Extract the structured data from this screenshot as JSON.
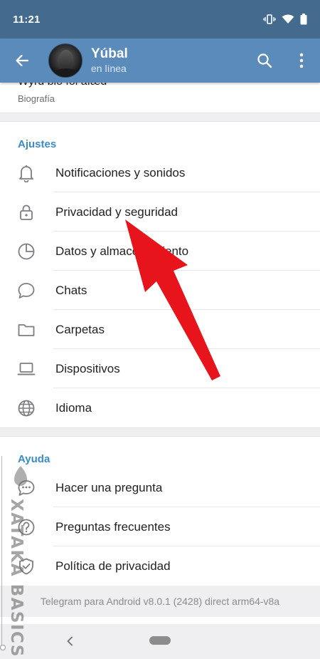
{
  "status_bar": {
    "time": "11:21"
  },
  "app_bar": {
    "name": "Yúbal",
    "status": "en línea"
  },
  "bio": {
    "value": "Wyrd bio fol afæd",
    "label": "Biografía"
  },
  "settings": {
    "header": "Ajustes",
    "items": [
      {
        "label": "Notificaciones y sonidos",
        "icon": "bell-icon"
      },
      {
        "label": "Privacidad y seguridad",
        "icon": "lock-icon"
      },
      {
        "label": "Datos y almacenamiento",
        "icon": "pie-chart-icon"
      },
      {
        "label": "Chats",
        "icon": "chat-bubble-icon"
      },
      {
        "label": "Carpetas",
        "icon": "folder-icon"
      },
      {
        "label": "Dispositivos",
        "icon": "laptop-icon"
      },
      {
        "label": "Idioma",
        "icon": "globe-icon"
      }
    ]
  },
  "help": {
    "header": "Ayuda",
    "items": [
      {
        "label": "Hacer una pregunta",
        "icon": "chat-dots-icon"
      },
      {
        "label": "Preguntas frecuentes",
        "icon": "question-icon"
      },
      {
        "label": "Política de privacidad",
        "icon": "shield-check-icon"
      }
    ]
  },
  "version_text": "Telegram para Android v8.0.1 (2428) direct arm64-v8a",
  "watermark": "XATAKA BASICS",
  "colors": {
    "app_bar": "#5b8bba",
    "status_bar": "#446a8d",
    "accent": "#3a8bc6",
    "arrow": "#e8141c"
  }
}
